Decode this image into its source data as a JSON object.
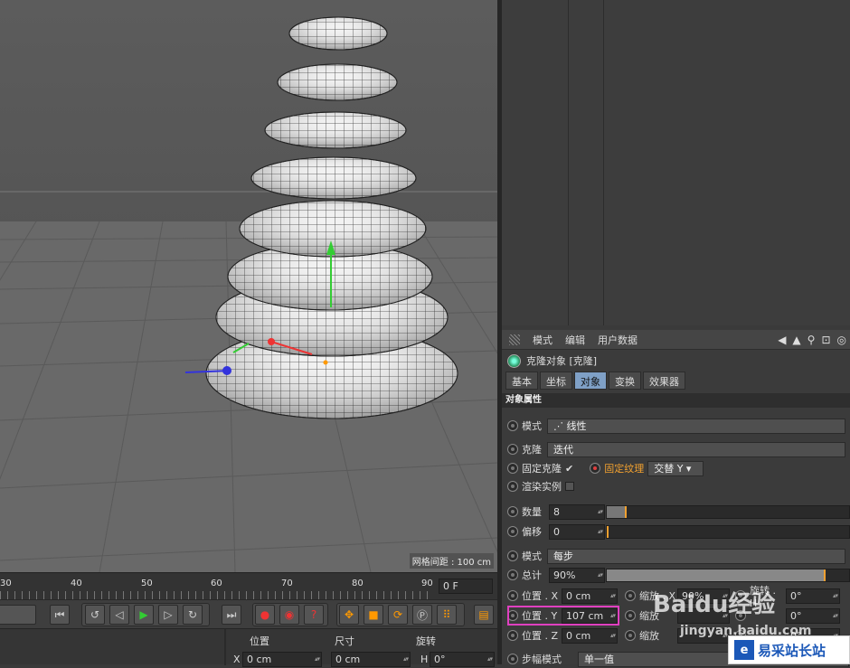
{
  "viewport": {
    "grid_spacing_label": "网格间距 : 100 cm"
  },
  "timeline": {
    "ticks": [
      "30",
      "40",
      "50",
      "60",
      "70",
      "80",
      "90"
    ],
    "current_frame": "0 F"
  },
  "coords": {
    "headers": [
      "位置",
      "尺寸",
      "旋转"
    ],
    "x_label": "X",
    "x_pos": "0 cm",
    "x_size": "0 cm",
    "h_label": "H",
    "h_rot": "0°"
  },
  "attributes": {
    "menu": [
      "模式",
      "编辑",
      "用户数据"
    ],
    "object_title": "克隆对象 [克隆]",
    "tabs": [
      "基本",
      "坐标",
      "对象",
      "变换",
      "效果器"
    ],
    "active_tab": "对象",
    "section_title": "对象属性",
    "mode_label": "模式",
    "mode_value": "线性",
    "clone_label": "克隆",
    "clone_value": "迭代",
    "fix_clone_label": "固定克隆",
    "fix_clone_check": "✔",
    "fix_texture_label": "固定纹理",
    "fix_texture_value": "交替 Y",
    "render_instance_label": "渲染实例",
    "count_label": "数量",
    "count_value": "8",
    "offset_label": "偏移",
    "offset_value": "0",
    "mode2_label": "模式",
    "mode2_value": "每步",
    "total_label": "总计",
    "total_value": "90%",
    "pos_x_label": "位置 . X",
    "pos_x_value": "0 cm",
    "pos_y_label": "位置 . Y",
    "pos_y_value": "107 cm",
    "pos_z_label": "位置 . Z",
    "pos_z_value": "0 cm",
    "scale_x_label": "缩放 . X",
    "scale_x_value": "90%",
    "rot_h_label": "旋转 . H",
    "rot_h_value": "0°",
    "scale_y_label": "缩放",
    "rot_p_value": "0°",
    "scale_z_label": "缩放",
    "rot_b_value": "0°",
    "step_mode_label": "步幅模式",
    "step_mode_value": "单一值"
  },
  "watermark": {
    "baidu": "Baidu经验",
    "url": "jingyan.baidu.com",
    "site_mark": "e",
    "site_name": "易采站长站"
  },
  "count_fraction": 0.08,
  "total_fraction": 0.9
}
